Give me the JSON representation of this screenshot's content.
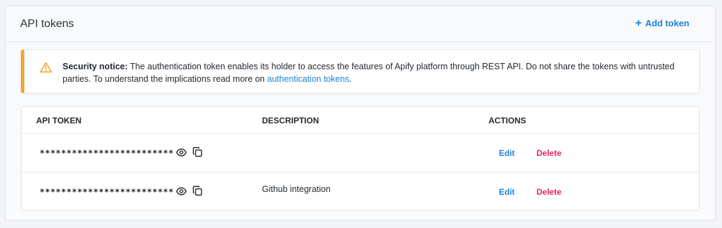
{
  "header": {
    "title": "API tokens",
    "add_token_label": "Add token"
  },
  "notice": {
    "bold_label": "Security notice:",
    "text_before_link": " The authentication token enables its holder to access the features of Apify platform through REST API. Do not share the tokens with untrusted parties. To understand the implications read more on ",
    "link_text": "authentication tokens",
    "text_after_link": "."
  },
  "table": {
    "columns": [
      "API TOKEN",
      "DESCRIPTION",
      "ACTIONS"
    ],
    "rows": [
      {
        "token_masked": "*************************",
        "description": "",
        "edit_label": "Edit",
        "delete_label": "Delete"
      },
      {
        "token_masked": "*************************",
        "description": "Github integration",
        "edit_label": "Edit",
        "delete_label": "Delete"
      }
    ]
  },
  "colors": {
    "accent": "#1e7fd6",
    "danger": "#e0245e",
    "warning": "#f6a431"
  },
  "icons": [
    "plus-icon",
    "warning-icon",
    "eye-icon",
    "copy-icon"
  ]
}
